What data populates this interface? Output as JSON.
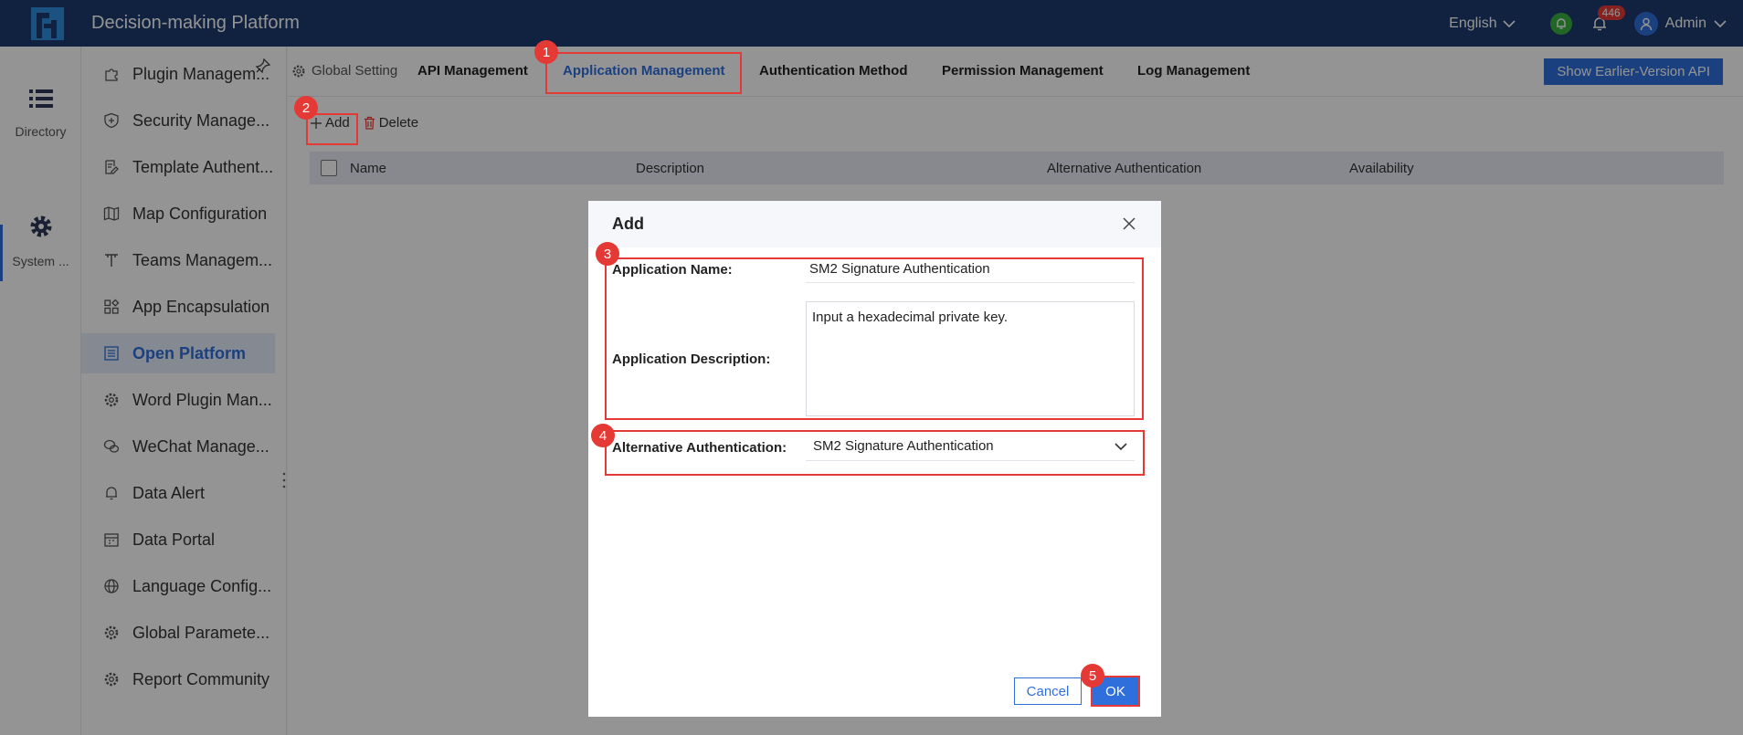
{
  "header": {
    "title": "Decision-making Platform",
    "language": "English",
    "notification_count": "446",
    "user": "Admin"
  },
  "rail": {
    "items": [
      {
        "label": "Directory"
      },
      {
        "label": "System ..."
      }
    ]
  },
  "sidebar": {
    "items": [
      {
        "label": "Plugin Managem..."
      },
      {
        "label": "Security Manage..."
      },
      {
        "label": "Template Authent..."
      },
      {
        "label": "Map Configuration"
      },
      {
        "label": "Teams Managem..."
      },
      {
        "label": "App Encapsulation"
      },
      {
        "label": "Open Platform"
      },
      {
        "label": "Word Plugin Man..."
      },
      {
        "label": "WeChat Manage..."
      },
      {
        "label": "Data Alert"
      },
      {
        "label": "Data Portal"
      },
      {
        "label": "Language Config..."
      },
      {
        "label": "Global Paramete..."
      },
      {
        "label": "Report Community"
      }
    ]
  },
  "tabs": {
    "global": "Global Setting",
    "items": [
      {
        "label": "API Management"
      },
      {
        "label": "Application Management"
      },
      {
        "label": "Authentication Method"
      },
      {
        "label": "Permission Management"
      },
      {
        "label": "Log Management"
      }
    ],
    "earlier_api": "Show Earlier-Version API"
  },
  "toolbar": {
    "add": "Add",
    "delete": "Delete"
  },
  "table": {
    "columns": [
      "Name",
      "Description",
      "Alternative Authentication",
      "Availability"
    ]
  },
  "dialog": {
    "title": "Add",
    "name_label": "Application Name:",
    "name_value": "SM2 Signature Authentication",
    "desc_label": "Application Description:",
    "desc_value": "Input a hexadecimal private key.",
    "auth_label": "Alternative Authentication:",
    "auth_value": "SM2 Signature Authentication",
    "cancel": "Cancel",
    "ok": "OK"
  },
  "annotations": [
    "1",
    "2",
    "3",
    "4",
    "5"
  ],
  "colors": {
    "header": "#1e3a6e",
    "accent": "#2f6fdc",
    "annotation": "#e53935"
  }
}
